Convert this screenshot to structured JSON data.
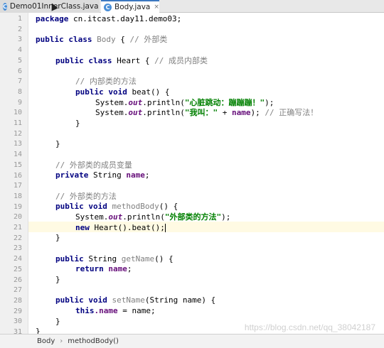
{
  "tabs": [
    {
      "label": "Demo01InnerClass.java",
      "icon": "class-icon",
      "close": "×"
    },
    {
      "label": "Body.java",
      "icon": "class-icon",
      "close": "×"
    }
  ],
  "line_numbers": [
    "1",
    "2",
    "3",
    "4",
    "5",
    "6",
    "7",
    "8",
    "9",
    "10",
    "11",
    "12",
    "13",
    "14",
    "15",
    "16",
    "17",
    "18",
    "19",
    "20",
    "21",
    "22",
    "23",
    "24",
    "25",
    "26",
    "27",
    "28",
    "29",
    "30",
    "31"
  ],
  "code": {
    "l1": {
      "kw": "package",
      "rest": " cn.itcast.day11.demo03;"
    },
    "l3": {
      "kw": "public class",
      "name": " Body",
      "rest": " { ",
      "cm": "// 外部类"
    },
    "l5": {
      "kw": "public class",
      "rest": " Heart { ",
      "cm": "// 成员内部类"
    },
    "l7": {
      "cm": "// 内部类的方法"
    },
    "l8": {
      "kw": "public void",
      "rest": " beat() {"
    },
    "l9": {
      "a": "System.",
      "f": "out",
      "b": ".println(",
      "s": "\"心脏跳动：蹦蹦蹦！\"",
      "c": ");"
    },
    "l10": {
      "a": "System.",
      "f": "out",
      "b": ".println(",
      "s": "\"我叫：\"",
      "c": " + ",
      "fd": "name",
      "d": "); ",
      "cm": "// 正确写法！"
    },
    "l11": {
      "rest": "}"
    },
    "l13": {
      "rest": "}"
    },
    "l15": {
      "cm": "// 外部类的成员变量"
    },
    "l16": {
      "kw": "private",
      "rest": " String ",
      "fd": "name",
      "end": ";"
    },
    "l18": {
      "cm": "// 外部类的方法"
    },
    "l19": {
      "kw": "public void",
      "name": " methodBody",
      "rest": "() {"
    },
    "l20": {
      "a": "System.",
      "f": "out",
      "b": ".println(",
      "s": "\"外部类的方法\"",
      "c": ");"
    },
    "l21": {
      "kw": "new",
      "rest": " Heart().beat();"
    },
    "l22": {
      "rest": "}"
    },
    "l24": {
      "kw": "public",
      "rest": " String ",
      "name": "getName",
      "rest2": "() {"
    },
    "l25": {
      "kw": "return",
      "fd": " name",
      "end": ";"
    },
    "l26": {
      "rest": "}"
    },
    "l28": {
      "kw": "public void",
      "name": " setName",
      "rest": "(String name) {"
    },
    "l29": {
      "kw": "this",
      "fd": ".name",
      "rest": " = name;"
    },
    "l30": {
      "rest": "}"
    },
    "l31": {
      "rest": "}"
    }
  },
  "breadcrumb": {
    "items": [
      "Body",
      "methodBody()"
    ],
    "separator": "›"
  },
  "watermark": "https://blog.csdn.net/qq_38042187",
  "colors": {
    "keyword": "#000080",
    "comment": "#808080",
    "string": "#008000",
    "field": "#660e7a",
    "current_line": "#fffae3"
  }
}
